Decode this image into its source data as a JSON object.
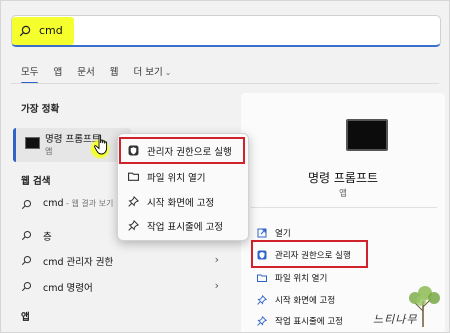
{
  "search": {
    "value": "cmd"
  },
  "tabs": [
    {
      "label": "모두",
      "active": true
    },
    {
      "label": "앱"
    },
    {
      "label": "문서"
    },
    {
      "label": "웹"
    },
    {
      "label": "더 보기"
    }
  ],
  "sections": {
    "best_match": "가장 정확",
    "web_search": "웹 검색",
    "apps": "앱"
  },
  "best_match": {
    "name": "명령 프롬프트",
    "type": "앱"
  },
  "web_results": [
    {
      "text": "cmd",
      "sub": " - 웹 결과 보기"
    },
    {
      "text": "층",
      "sub": ""
    },
    {
      "text": "cmd 관리자 권한",
      "sub": ""
    },
    {
      "text": "cmd 명령어",
      "sub": ""
    }
  ],
  "context_menu": [
    {
      "label": "관리자 권한으로 실행",
      "icon": "shield-icon"
    },
    {
      "label": "파일 위치 열기",
      "icon": "folder-icon"
    },
    {
      "label": "시작 화면에 고정",
      "icon": "pin-icon"
    },
    {
      "label": "작업 표시줄에 고정",
      "icon": "pin-icon"
    }
  ],
  "right_panel": {
    "title": "명령 프롬프트",
    "subtitle": "앱",
    "actions": [
      {
        "label": "열기",
        "icon": "open-icon"
      },
      {
        "label": "관리자 권한으로 실행",
        "icon": "shield-icon"
      },
      {
        "label": "파일 위치 열기",
        "icon": "folder-icon"
      },
      {
        "label": "시작 화면에 고정",
        "icon": "pin-icon"
      },
      {
        "label": "작업 표시줄에 고정",
        "icon": "pin-icon"
      }
    ]
  },
  "watermark": {
    "text": "느티나무"
  },
  "colors": {
    "accent": "#2f63c6",
    "highlight_yellow": "#f5ff2e",
    "annotation_red": "#d0222a"
  }
}
